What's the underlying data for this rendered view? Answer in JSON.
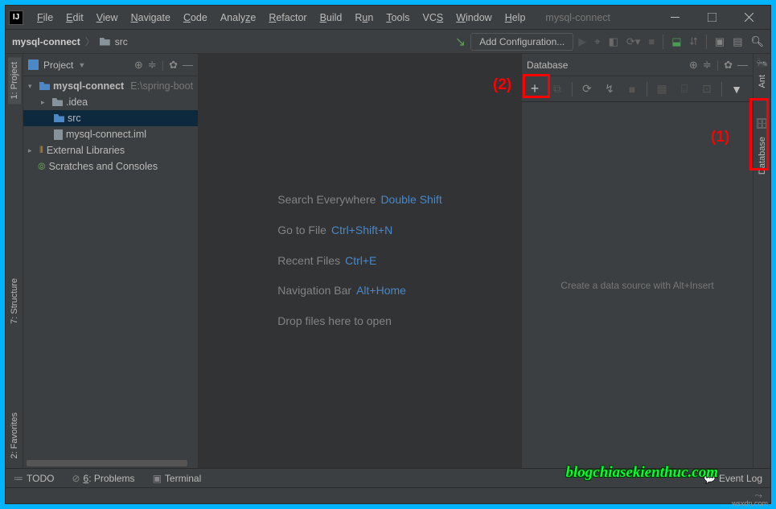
{
  "menus": [
    "File",
    "Edit",
    "View",
    "Navigate",
    "Code",
    "Analyze",
    "Refactor",
    "Build",
    "Run",
    "Tools",
    "VCS",
    "Window",
    "Help"
  ],
  "title": "mysql-connect",
  "breadcrumb": {
    "project": "mysql-connect",
    "folder": "src"
  },
  "runConfig": "Add Configuration...",
  "leftGutter": {
    "project": "1: Project",
    "structure": "7: Structure",
    "favorites": "2: Favorites"
  },
  "rightGutter": {
    "ant": "Ant",
    "database": "Database"
  },
  "projectPanel": {
    "title": "Project",
    "root": {
      "name": "mysql-connect",
      "path": "E:\\spring-boot"
    },
    "items": {
      "idea": ".idea",
      "src": "src",
      "iml": "mysql-connect.iml",
      "libs": "External Libraries",
      "scratches": "Scratches and Consoles"
    }
  },
  "hints": {
    "searchLabel": "Search Everywhere",
    "searchKey": "Double Shift",
    "gotoLabel": "Go to File",
    "gotoKey": "Ctrl+Shift+N",
    "recentLabel": "Recent Files",
    "recentKey": "Ctrl+E",
    "navLabel": "Navigation Bar",
    "navKey": "Alt+Home",
    "dropLabel": "Drop files here to open"
  },
  "dbPanel": {
    "title": "Database",
    "placeholder": "Create a data source with Alt+Insert"
  },
  "bottomBar": {
    "todo": "TODO",
    "problems": "6: Problems",
    "terminal": "Terminal",
    "eventLog": "Event Log"
  },
  "annotations": {
    "a1": "(1)",
    "a2": "(2)"
  },
  "watermark": "blogchiasekienthuc.com",
  "sitetag": "wsxdn.com"
}
